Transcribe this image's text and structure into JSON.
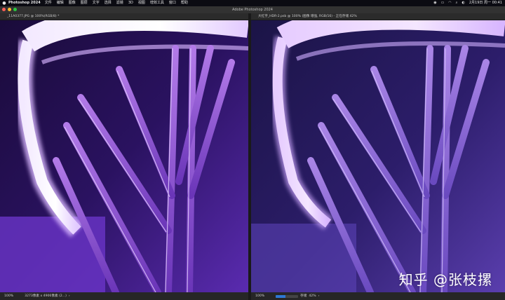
{
  "menubar": {
    "app_name": "Photoshop 2024",
    "items": [
      "文件",
      "编辑",
      "图像",
      "图层",
      "文字",
      "选择",
      "滤镜",
      "3D",
      "视图",
      "增效工具",
      "窗口",
      "帮助"
    ],
    "clock": "2月19日 周一  00:41"
  },
  "window": {
    "title": "Adobe Photoshop 2024"
  },
  "left_doc": {
    "tab_label": "_11A0377.JPG @ 100%(RGB/8) *",
    "zoom": "100%",
    "status_info": "3273像素 x 4906像素 (2...)"
  },
  "right_doc": {
    "tab_label": "大红字_HDR-2.psb @ 100% (图像 增强, RGB/16) - 正在存储 42%",
    "zoom": "100%",
    "save_label": "存储",
    "save_progress_text": "42%",
    "save_progress": 0.42
  },
  "watermark": "知乎 @张枝摞",
  "colors": {
    "accent": "#2e78d2",
    "close": "#ff5f57",
    "minimize": "#febc2e",
    "maximize": "#28c840"
  }
}
